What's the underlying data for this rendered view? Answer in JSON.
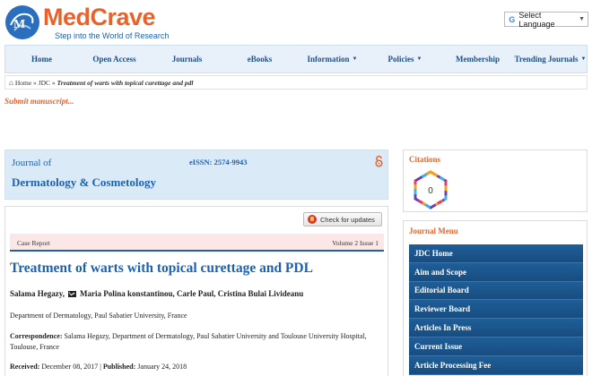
{
  "header": {
    "brand": "MedCrave",
    "tagline": "Step into the World of Research",
    "language_select": "Select Language"
  },
  "nav": {
    "items": [
      {
        "label": "Home",
        "dropdown": false
      },
      {
        "label": "Open Access",
        "dropdown": false
      },
      {
        "label": "Journals",
        "dropdown": false
      },
      {
        "label": "eBooks",
        "dropdown": false
      },
      {
        "label": "Information",
        "dropdown": true
      },
      {
        "label": "Policies",
        "dropdown": true
      },
      {
        "label": "Membership",
        "dropdown": false
      },
      {
        "label": "Trending Journals",
        "dropdown": true
      }
    ]
  },
  "breadcrumb": {
    "home": "Home",
    "sep1": "»",
    "journal": "JDC",
    "sep2": "»",
    "current": "Treatment of warts with topical curettage and pdl"
  },
  "submit_link": "Submit manuscript...",
  "journal_box": {
    "line1": "Journal of",
    "line2": "Dermatology & Cosmetology",
    "eissn": "eISSN: 2574-9943"
  },
  "article": {
    "check_updates": "Check for updates",
    "type": "Case Report",
    "volume": "Volume 2 Issue 1",
    "title": "Treatment of warts with topical curettage and PDL",
    "author1": "Salama Hegazy,",
    "authors_rest": "Maria Polina konstantinou, Carle Paul, Cristina Bulai Livideanu",
    "department": "Department of Dermatology, Paul Sabatier University, France",
    "correspondence_label": "Correspondence:",
    "correspondence_text": "Salama Hegazy, Department of Dermatology, Paul Sabatier University and Toulouse University Hospital, Toulouse, France",
    "received_label": "Received:",
    "received_date": "December 08, 2017",
    "published_label": "Published:",
    "published_date": "January 24, 2018"
  },
  "citations": {
    "title": "Citations",
    "count": "0"
  },
  "journal_menu": {
    "title": "Journal Menu",
    "items": [
      "JDC Home",
      "Aim and Scope",
      "Editorial Board",
      "Reviewer Board",
      "Articles In Press",
      "Current Issue",
      "Article Processing Fee"
    ]
  },
  "colors": {
    "brand_orange": "#e8632b",
    "brand_blue": "#1b62b3",
    "menu_blue": "#1f5e98"
  }
}
